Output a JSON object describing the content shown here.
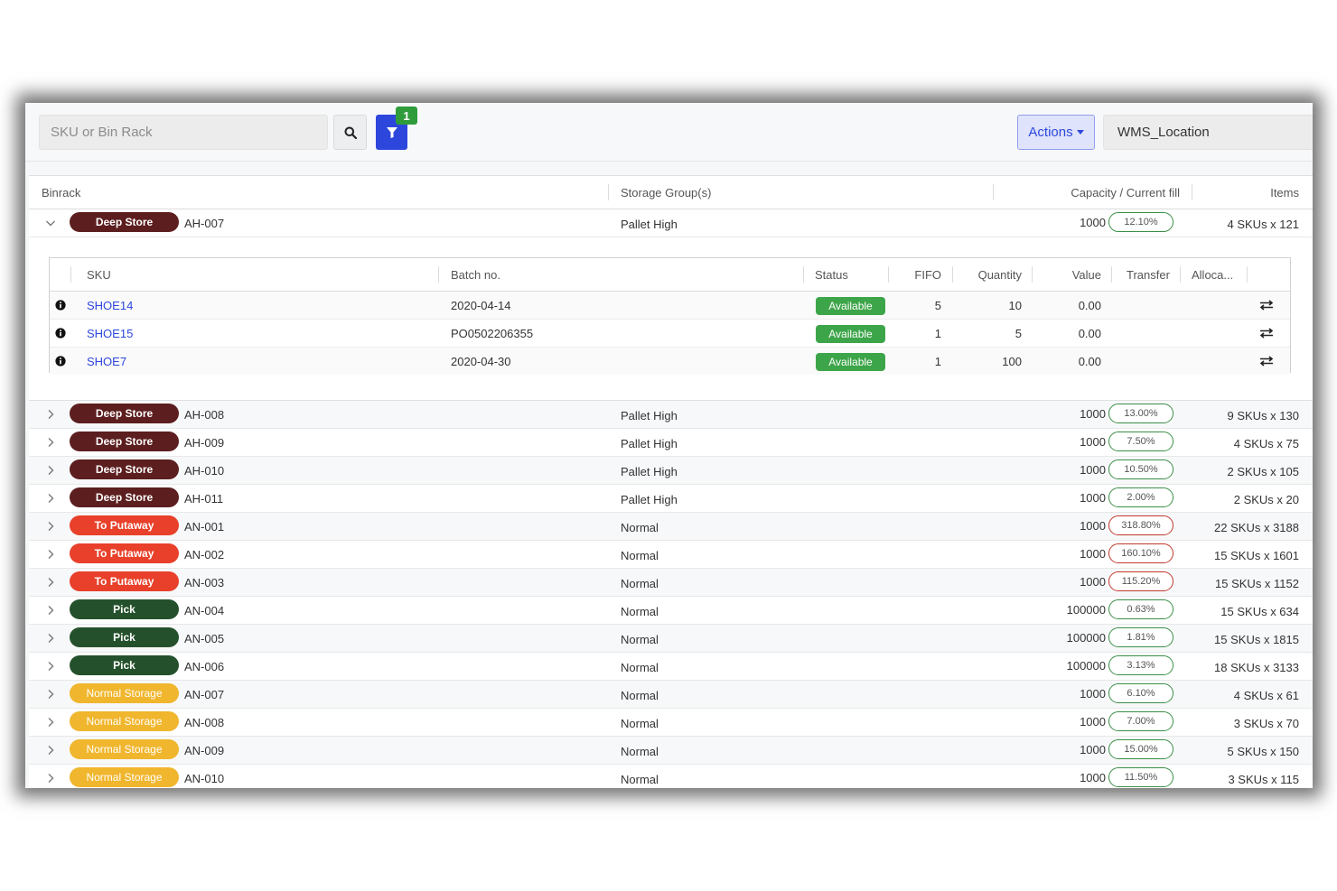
{
  "toolbar": {
    "search_placeholder": "SKU or Bin Rack",
    "filter_count": "1",
    "actions_label": "Actions",
    "location": "WMS_Location"
  },
  "table": {
    "headers": {
      "binrack": "Binrack",
      "storage_groups": "Storage Group(s)",
      "capacity": "Capacity / Current fill",
      "items": "Items"
    },
    "expanded_row": {
      "tag": "Deep Store",
      "tag_color": "#5c1e1e",
      "rack": "AH-007",
      "group": "Pallet High",
      "capacity": "1000",
      "fill": "12.10%",
      "items": "4 SKUs x 121"
    },
    "sub_table": {
      "headers": {
        "sku": "SKU",
        "batch": "Batch no.",
        "status": "Status",
        "fifo": "FIFO",
        "quantity": "Quantity",
        "value": "Value",
        "transfer": "Transfer",
        "allocated": "Alloca..."
      },
      "rows": [
        {
          "sku": "SHOE14",
          "batch": "2020-04-14",
          "status": "Available",
          "fifo": "5",
          "quantity": "10",
          "value": "0.00"
        },
        {
          "sku": "SHOE15",
          "batch": "PO0502206355",
          "status": "Available",
          "fifo": "1",
          "quantity": "5",
          "value": "0.00"
        },
        {
          "sku": "SHOE7",
          "batch": "2020-04-30",
          "status": "Available",
          "fifo": "1",
          "quantity": "100",
          "value": "0.00"
        }
      ]
    },
    "rows": [
      {
        "tag": "Deep Store",
        "tag_color": "#5c1e1e",
        "rack": "AH-008",
        "group": "Pallet High",
        "capacity": "1000",
        "fill": "13.00%",
        "over": false,
        "items": "9 SKUs x 130"
      },
      {
        "tag": "Deep Store",
        "tag_color": "#5c1e1e",
        "rack": "AH-009",
        "group": "Pallet High",
        "capacity": "1000",
        "fill": "7.50%",
        "over": false,
        "items": "4 SKUs x 75"
      },
      {
        "tag": "Deep Store",
        "tag_color": "#5c1e1e",
        "rack": "AH-010",
        "group": "Pallet High",
        "capacity": "1000",
        "fill": "10.50%",
        "over": false,
        "items": "2 SKUs x 105"
      },
      {
        "tag": "Deep Store",
        "tag_color": "#5c1e1e",
        "rack": "AH-011",
        "group": "Pallet High",
        "capacity": "1000",
        "fill": "2.00%",
        "over": false,
        "items": "2 SKUs x 20"
      },
      {
        "tag": "To Putaway",
        "tag_color": "#e8402a",
        "rack": "AN-001",
        "group": "Normal",
        "capacity": "1000",
        "fill": "318.80%",
        "over": true,
        "items": "22 SKUs x 3188"
      },
      {
        "tag": "To Putaway",
        "tag_color": "#e8402a",
        "rack": "AN-002",
        "group": "Normal",
        "capacity": "1000",
        "fill": "160.10%",
        "over": true,
        "items": "15 SKUs x 1601"
      },
      {
        "tag": "To Putaway",
        "tag_color": "#e8402a",
        "rack": "AN-003",
        "group": "Normal",
        "capacity": "1000",
        "fill": "115.20%",
        "over": true,
        "items": "15 SKUs x 1152"
      },
      {
        "tag": "Pick",
        "tag_color": "#24512c",
        "rack": "AN-004",
        "group": "Normal",
        "capacity": "100000",
        "fill": "0.63%",
        "over": false,
        "items": "15 SKUs x 634"
      },
      {
        "tag": "Pick",
        "tag_color": "#24512c",
        "rack": "AN-005",
        "group": "Normal",
        "capacity": "100000",
        "fill": "1.81%",
        "over": false,
        "items": "15 SKUs x 1815"
      },
      {
        "tag": "Pick",
        "tag_color": "#24512c",
        "rack": "AN-006",
        "group": "Normal",
        "capacity": "100000",
        "fill": "3.13%",
        "over": false,
        "items": "18 SKUs x 3133"
      },
      {
        "tag": "Normal Storage",
        "tag_color": "#f0b62d",
        "rack": "AN-007",
        "group": "Normal",
        "capacity": "1000",
        "fill": "6.10%",
        "over": false,
        "items": "4 SKUs x 61"
      },
      {
        "tag": "Normal Storage",
        "tag_color": "#f0b62d",
        "rack": "AN-008",
        "group": "Normal",
        "capacity": "1000",
        "fill": "7.00%",
        "over": false,
        "items": "3 SKUs x 70"
      },
      {
        "tag": "Normal Storage",
        "tag_color": "#f0b62d",
        "rack": "AN-009",
        "group": "Normal",
        "capacity": "1000",
        "fill": "15.00%",
        "over": false,
        "items": "5 SKUs x 150"
      },
      {
        "tag": "Normal Storage",
        "tag_color": "#f0b62d",
        "rack": "AN-010",
        "group": "Normal",
        "capacity": "1000",
        "fill": "11.50%",
        "over": false,
        "items": "3 SKUs x 115"
      }
    ]
  },
  "icons": {
    "search": "search-icon",
    "filter": "filter-icon",
    "expand": "chevron-right-icon",
    "collapse": "chevron-down-icon",
    "info": "info-circle-icon",
    "transfer": "transfer-arrows-icon"
  }
}
